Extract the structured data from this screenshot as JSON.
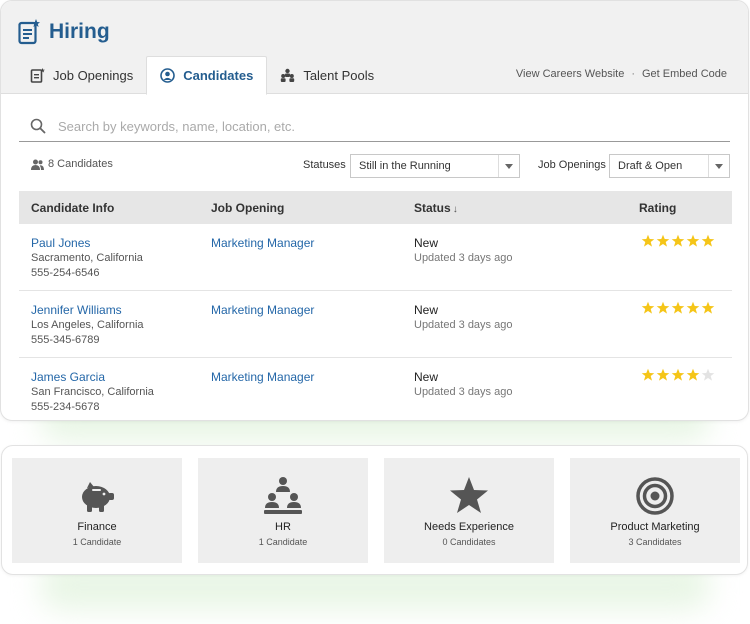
{
  "app": {
    "title": "Hiring",
    "icon": "clipboard-star-icon",
    "accent": "#245d8f",
    "link_color": "#2467a8"
  },
  "tabs": [
    {
      "label": "Job Openings",
      "icon": "clipboard-icon",
      "active": false
    },
    {
      "label": "Candidates",
      "icon": "user-circle-icon",
      "active": true
    },
    {
      "label": "Talent Pools",
      "icon": "group-icon",
      "active": false
    }
  ],
  "top_links": {
    "careers": "View Careers Website",
    "separator": "·",
    "embed": "Get Embed Code"
  },
  "search": {
    "placeholder": "Search by keywords, name, location, etc.",
    "value": ""
  },
  "filters": {
    "count": "8 Candidates",
    "statuses_label": "Statuses",
    "statuses_value": "Still in the Running",
    "openings_label": "Job Openings",
    "openings_value": "Draft & Open"
  },
  "table": {
    "headers": {
      "candidate": "Candidate Info",
      "job": "Job Opening",
      "status": "Status",
      "sort_arrow": "↓",
      "rating": "Rating"
    },
    "rows": [
      {
        "name": "Paul Jones",
        "location": "Sacramento, California",
        "phone": "555-254-6546",
        "job": "Marketing Manager",
        "status": "New",
        "updated": "Updated 3 days ago",
        "rating": 5
      },
      {
        "name": "Jennifer Williams",
        "location": "Los Angeles, California",
        "phone": "555-345-6789",
        "job": "Marketing Manager",
        "status": "New",
        "updated": "Updated 3 days ago",
        "rating": 5
      },
      {
        "name": "James Garcia",
        "location": "San Francisco, California",
        "phone": "555-234-5678",
        "job": "Marketing Manager",
        "status": "New",
        "updated": "Updated 3 days ago",
        "rating": 4
      }
    ],
    "rating_max": 5,
    "star_color": "#f5c518",
    "star_empty_color": "#e3e3e3"
  },
  "pools": [
    {
      "name": "Finance",
      "count": "1 Candidate",
      "icon": "piggy-bank-icon"
    },
    {
      "name": "HR",
      "count": "1 Candidate",
      "icon": "people-pyramid-icon"
    },
    {
      "name": "Needs Experience",
      "count": "0 Candidates",
      "icon": "star-icon"
    },
    {
      "name": "Product Marketing",
      "count": "3 Candidates",
      "icon": "target-icon"
    }
  ]
}
